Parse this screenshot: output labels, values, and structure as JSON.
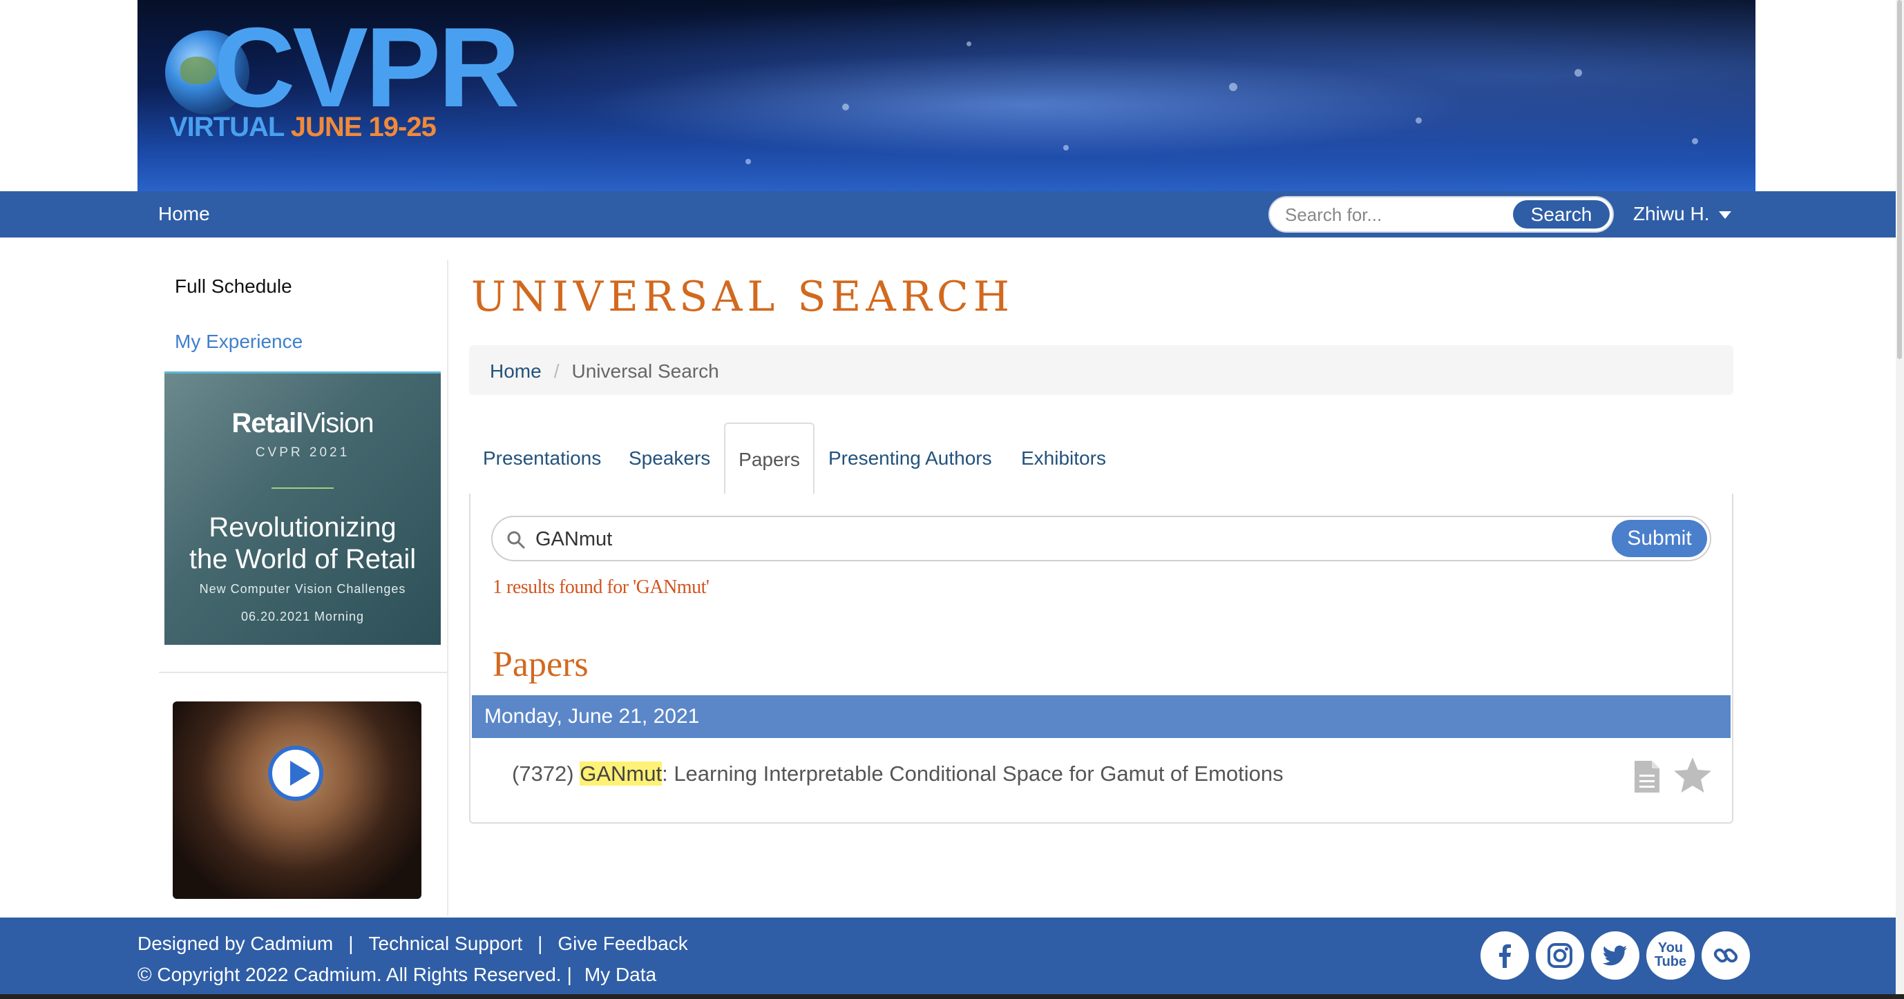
{
  "banner": {
    "logo_text": "CVPR",
    "logo_virtual": "VIRTUAL",
    "logo_dates": "JUNE 19-25"
  },
  "topnav": {
    "home_label": "Home",
    "search_placeholder": "Search for...",
    "search_button": "Search",
    "user_label": "Zhiwu H."
  },
  "sidebar": {
    "full_schedule": "Full Schedule",
    "my_experience": "My Experience",
    "promo": {
      "brand_bold": "Retail",
      "brand_light": "Vision",
      "sub": "CVPR 2021",
      "headline_line1": "Revolutionizing",
      "headline_line2": "the World of Retail",
      "description": "New Computer Vision Challenges",
      "date": "06.20.2021 Morning"
    }
  },
  "main": {
    "page_title": "UNIVERSAL SEARCH",
    "breadcrumb": {
      "home": "Home",
      "separator": "/",
      "current": "Universal Search"
    },
    "tabs": [
      {
        "label": "Presentations"
      },
      {
        "label": "Speakers"
      },
      {
        "label": "Papers",
        "active": true
      },
      {
        "label": "Presenting Authors"
      },
      {
        "label": "Exhibitors"
      }
    ],
    "search": {
      "value": "GANmut",
      "submit_label": "Submit"
    },
    "results_count": "1 results found for 'GANmut'",
    "section_title": "Papers",
    "date_heading": "Monday, June 21, 2021",
    "paper": {
      "id": "(7372)",
      "highlight": "GANmut",
      "title_rest": ": Learning Interpretable Conditional Space for Gamut of Emotions"
    }
  },
  "footer": {
    "designed_by": "Designed by Cadmium",
    "sep": "|",
    "technical_support": "Technical Support",
    "give_feedback": "Give Feedback",
    "copyright": "© Copyright 2022 Cadmium. All Rights Reserved.",
    "my_data": "My Data",
    "social_icons": [
      "facebook-icon",
      "instagram-icon",
      "twitter-icon",
      "youtube-icon",
      "link-icon"
    ],
    "youtube_label_top": "You",
    "youtube_label_bottom": "Tube"
  },
  "colors": {
    "nav_blue": "#2f5ea6",
    "accent_orange": "#d2691e",
    "date_bar_blue": "#5b87c9",
    "highlight_yellow": "#fff176"
  }
}
